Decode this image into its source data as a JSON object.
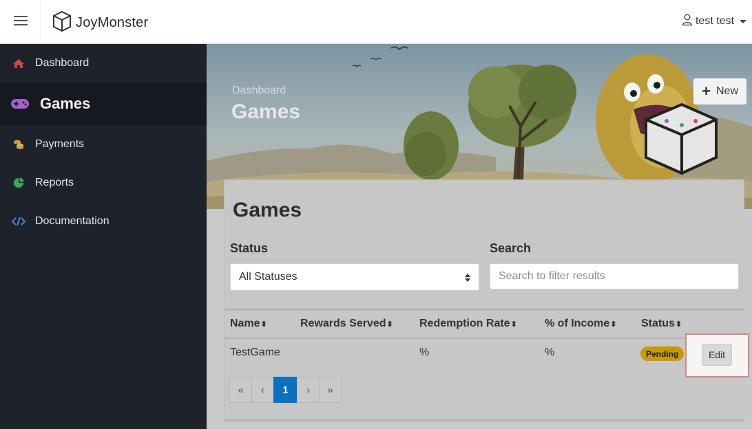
{
  "header": {
    "brand": "JoyMonster",
    "user": "test test"
  },
  "sidebar": {
    "items": [
      {
        "label": "Dashboard",
        "icon": "home-icon",
        "color": "#d9434b"
      },
      {
        "label": "Games",
        "icon": "gamepad-icon",
        "color": "#a064c8",
        "active": true
      },
      {
        "label": "Payments",
        "icon": "coins-icon",
        "color": "#c8a03c"
      },
      {
        "label": "Reports",
        "icon": "pie-chart-icon",
        "color": "#3aa85c"
      },
      {
        "label": "Documentation",
        "icon": "code-icon",
        "color": "#3c8ad8"
      }
    ]
  },
  "hero": {
    "breadcrumb": "Dashboard",
    "title": "Games",
    "new_button": "New"
  },
  "card": {
    "title": "Games",
    "status_label": "Status",
    "status_value": "All Statuses",
    "search_label": "Search",
    "search_placeholder": "Search to filter results"
  },
  "table": {
    "columns": [
      "Name",
      "Rewards Served",
      "Redemption Rate",
      "% of Income",
      "Status"
    ],
    "sort_glyph": "⬍",
    "rows": [
      {
        "name": "TestGame",
        "rewards_served": "",
        "redemption_rate": "%",
        "income": "%",
        "status": "Pending",
        "action": "Edit"
      }
    ]
  },
  "pagination": {
    "first": "«",
    "prev": "‹",
    "current": "1",
    "next": "›",
    "last": "»"
  },
  "colors": {
    "pending_badge": "#c99a00",
    "active_page": "#0b70c0",
    "highlight_border": "#d98585"
  }
}
